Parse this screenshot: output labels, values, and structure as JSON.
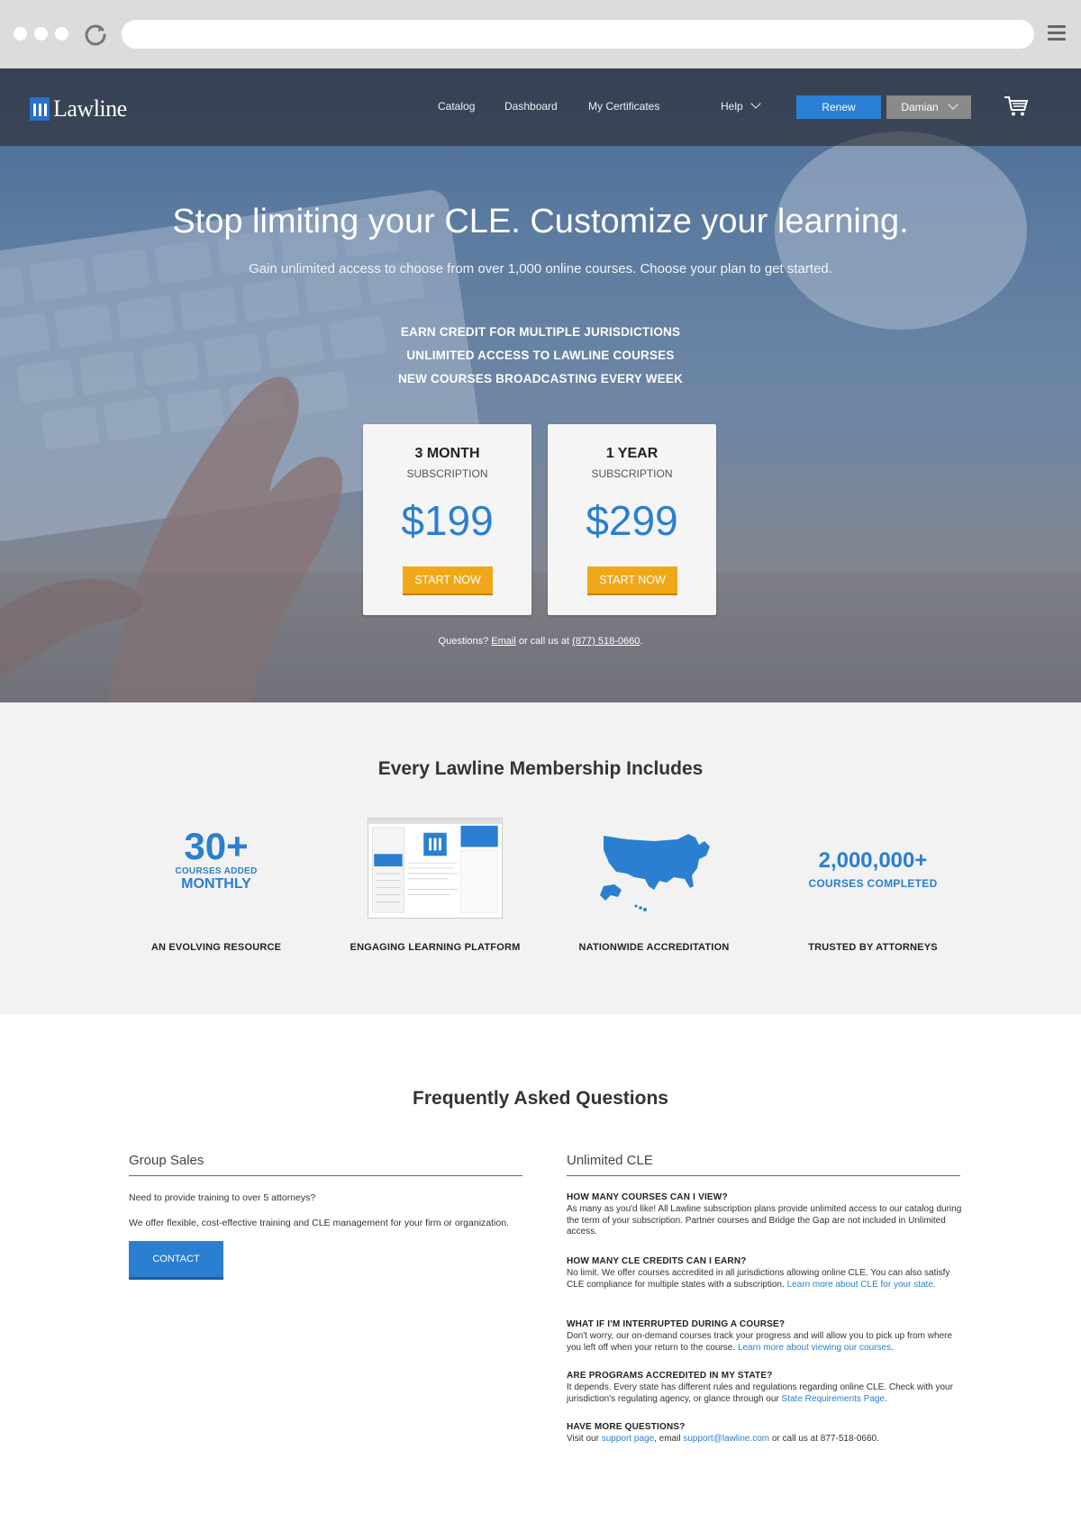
{
  "browser": {
    "url": ""
  },
  "nav": {
    "logo": "Lawline",
    "links": [
      "Catalog",
      "Dashboard",
      "My Certificates"
    ],
    "help": "Help",
    "renew": "Renew",
    "user": "Damian"
  },
  "hero": {
    "title": "Stop limiting your CLE. Customize your learning.",
    "subtitle": "Gain unlimited access to choose from over 1,000 online courses. Choose your plan to get started.",
    "bullets": [
      "EARN CREDIT FOR MULTIPLE JURISDICTIONS",
      "UNLIMITED ACCESS TO LAWLINE COURSES",
      "NEW COURSES BROADCASTING EVERY WEEK"
    ],
    "plans": [
      {
        "name": "3 MONTH",
        "type": "SUBSCRIPTION",
        "price": "$199",
        "cta": "START NOW"
      },
      {
        "name": "1 YEAR",
        "type": "SUBSCRIPTION",
        "price": "$299",
        "cta": "START NOW"
      }
    ],
    "questions_prefix": "Questions?",
    "questions_email": "Email",
    "questions_mid": "or call us at",
    "questions_phone": "(877) 518-0660",
    "questions_suffix": "."
  },
  "membership": {
    "title": "Every Lawline Membership Includes",
    "stat_30": "30+",
    "stat_30_small": "COURSES ADDED",
    "stat_30_word": "MONTHLY",
    "stat_2m": "2,000,000+",
    "stat_2m_sub": "COURSES COMPLETED",
    "items": [
      "AN EVOLVING RESOURCE",
      "ENGAGING LEARNING PLATFORM",
      "NATIONWIDE ACCREDITATION",
      "TRUSTED BY ATTORNEYS"
    ]
  },
  "faq": {
    "title": "Frequently Asked Questions",
    "group": {
      "heading": "Group Sales",
      "line1": "Need to provide training to over 5 attorneys?",
      "line2": "We offer flexible, cost-effective training and CLE management for your firm or organization.",
      "cta": "CONTACT"
    },
    "unlimited": {
      "heading": "Unlimited CLE",
      "items": [
        {
          "q": "HOW MANY COURSES CAN I VIEW?",
          "a": "As many as you'd like! All Lawline subscription plans provide unlimited access to our catalog during the term of your subscription. Partner courses and Bridge the Gap are not included in Unlimited access.",
          "link": ""
        },
        {
          "q": "HOW MANY CLE CREDITS CAN I EARN?",
          "a": "No limit. We offer courses accredited in all jurisdictions allowing online CLE. You can also satisfy CLE compliance for multiple states with a subscription.",
          "link": "Learn more about CLE for your state",
          "tail": "."
        },
        {
          "q": "WHAT IF I'M INTERRUPTED DURING A COURSE?",
          "a": "Don't worry, our on-demand courses track your progress and will allow you to pick up from where you left off when your return to the course.",
          "link": "Learn more about viewing our courses",
          "tail": "."
        },
        {
          "q": "ARE PROGRAMS ACCREDITED IN MY STATE?",
          "a": "It depends. Every state has different rules and regulations regarding online CLE. Check with your jurisdiction's regulating agency, or glance through our",
          "link": "State Requirements Page",
          "tail": "."
        },
        {
          "q": "HAVE MORE QUESTIONS?",
          "a": "Visit our",
          "link": "support page",
          "mid": ", email",
          "link2": "support@lawline.com",
          "tail": "or call us at 877-518-0660."
        }
      ]
    }
  },
  "colors": {
    "accent": "#2a7fd0",
    "cta": "#f0a81a",
    "nav_bg": "#3c3631"
  }
}
